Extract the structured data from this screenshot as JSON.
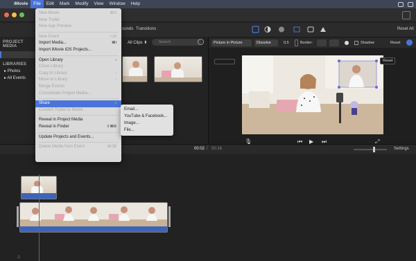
{
  "menubar": {
    "app": "iMovie",
    "items": [
      "File",
      "Edit",
      "Mark",
      "Modify",
      "View",
      "Window",
      "Help"
    ]
  },
  "file_menu": {
    "rows": [
      {
        "label": "New Movie",
        "shortcut": "⌘N",
        "enabled": false
      },
      {
        "label": "New Trailer",
        "shortcut": "",
        "enabled": false
      },
      {
        "label": "New App Preview",
        "shortcut": "",
        "enabled": false
      },
      {
        "sep": true
      },
      {
        "label": "New Event",
        "shortcut": "⌥N",
        "enabled": false
      },
      {
        "label": "Import Media...",
        "shortcut": "⌘I",
        "enabled": true
      },
      {
        "label": "Import iMovie iOS Projects...",
        "shortcut": "",
        "enabled": true
      },
      {
        "sep": true
      },
      {
        "label": "Open Library",
        "shortcut": "›",
        "enabled": true
      },
      {
        "label": "Close Library",
        "shortcut": "",
        "enabled": false
      },
      {
        "label": "Copy to Library",
        "shortcut": "›",
        "enabled": false
      },
      {
        "label": "Move to Library",
        "shortcut": "›",
        "enabled": false
      },
      {
        "label": "Merge Events",
        "shortcut": "",
        "enabled": false
      },
      {
        "label": "Consolidate Project Media...",
        "shortcut": "",
        "enabled": false
      },
      {
        "sep": true
      },
      {
        "label": "Share",
        "shortcut": "›",
        "enabled": true,
        "highlight": true
      },
      {
        "label": "Convert Trailer to Movie",
        "shortcut": "",
        "enabled": false
      },
      {
        "sep": true
      },
      {
        "label": "Reveal in Project Media",
        "shortcut": "",
        "enabled": true
      },
      {
        "label": "Reveal in Finder",
        "shortcut": "⇧⌘R",
        "enabled": true
      },
      {
        "sep": true
      },
      {
        "label": "Update Projects and Events...",
        "shortcut": "",
        "enabled": true
      },
      {
        "sep": true
      },
      {
        "label": "Delete Media from Event",
        "shortcut": "⌘⌫",
        "enabled": false
      }
    ]
  },
  "share_submenu": [
    "Email...",
    "YouTube & Facebook...",
    "Image...",
    "File..."
  ],
  "toolbar": {
    "tab_sounds": "ounds",
    "tab_transitions": "Transitions",
    "reset_all": "Reset All"
  },
  "sidebar": {
    "project_media": "PROJECT MEDIA",
    "libraries": "LIBRARIES",
    "photos": "Photos",
    "all_events": "All Events"
  },
  "browser": {
    "filter": "All Clips ⬍",
    "search_placeholder": "Search"
  },
  "viewer": {
    "mode": "Picture in Picture",
    "transition": "Dissolve",
    "duration": "0,5",
    "border_label": "Border:",
    "shadow_label": "Shadow",
    "reset": "Reset",
    "tooltip": "Reset"
  },
  "timeline": {
    "current": "00:02",
    "total": "00:16",
    "settings": "Settings"
  },
  "colors": {
    "accent": "#4a74d9",
    "menubar": "#3d4556",
    "clip_bar": "#3d64b8"
  }
}
